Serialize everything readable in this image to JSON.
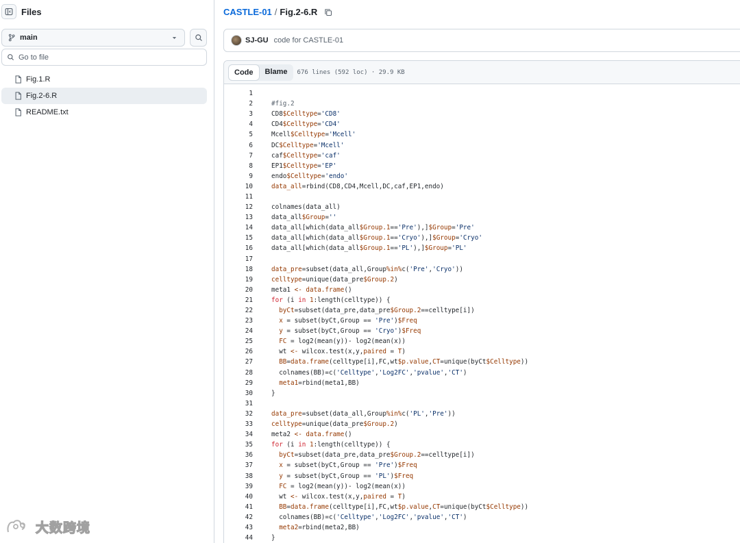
{
  "sidebar": {
    "title": "Files",
    "branch": "main",
    "goto_placeholder": "Go to file",
    "files": [
      {
        "name": "Fig.1.R",
        "active": false
      },
      {
        "name": "Fig.2-6.R",
        "active": true
      },
      {
        "name": "README.txt",
        "active": false
      }
    ]
  },
  "breadcrumb": {
    "repo": "CASTLE-01",
    "separator": "/",
    "file": "Fig.2-6.R"
  },
  "commit": {
    "author": "SJ-GU",
    "message": "code for CASTLE-01"
  },
  "code_toolbar": {
    "code_tab": "Code",
    "blame_tab": "Blame",
    "file_info": "676 lines (592 loc) · 29.9 KB"
  },
  "code": {
    "lines": [
      [],
      [
        [
          "c",
          "#fig.2"
        ]
      ],
      [
        [
          "p",
          "CD8"
        ],
        [
          "v",
          "$Celltype"
        ],
        [
          "p",
          "="
        ],
        [
          "s",
          "'CD8'"
        ]
      ],
      [
        [
          "p",
          "CD4"
        ],
        [
          "v",
          "$Celltype"
        ],
        [
          "p",
          "="
        ],
        [
          "s",
          "'CD4'"
        ]
      ],
      [
        [
          "p",
          "Mcell"
        ],
        [
          "v",
          "$Celltype"
        ],
        [
          "p",
          "="
        ],
        [
          "s",
          "'Mcell'"
        ]
      ],
      [
        [
          "p",
          "DC"
        ],
        [
          "v",
          "$Celltype"
        ],
        [
          "p",
          "="
        ],
        [
          "s",
          "'Mcell'"
        ]
      ],
      [
        [
          "p",
          "caf"
        ],
        [
          "v",
          "$Celltype"
        ],
        [
          "p",
          "="
        ],
        [
          "s",
          "'caf'"
        ]
      ],
      [
        [
          "p",
          "EP1"
        ],
        [
          "v",
          "$Celltype"
        ],
        [
          "p",
          "="
        ],
        [
          "s",
          "'EP'"
        ]
      ],
      [
        [
          "p",
          "endo"
        ],
        [
          "v",
          "$Celltype"
        ],
        [
          "p",
          "="
        ],
        [
          "s",
          "'endo'"
        ]
      ],
      [
        [
          "v",
          "data_all"
        ],
        [
          "p",
          "=rbind(CD8,CD4,Mcell,DC,caf,EP1,endo)"
        ]
      ],
      [],
      [
        [
          "p",
          "colnames(data_all)"
        ]
      ],
      [
        [
          "p",
          "data_all"
        ],
        [
          "v",
          "$Group"
        ],
        [
          "p",
          "="
        ],
        [
          "s",
          "''"
        ]
      ],
      [
        [
          "p",
          "data_all[which(data_all"
        ],
        [
          "v",
          "$Group.1"
        ],
        [
          "p",
          "=="
        ],
        [
          "s",
          "'Pre'"
        ],
        [
          "p",
          "),]"
        ],
        [
          "v",
          "$Group"
        ],
        [
          "p",
          "="
        ],
        [
          "s",
          "'Pre'"
        ]
      ],
      [
        [
          "p",
          "data_all[which(data_all"
        ],
        [
          "v",
          "$Group.1"
        ],
        [
          "p",
          "=="
        ],
        [
          "s",
          "'Cryo'"
        ],
        [
          "p",
          "),]"
        ],
        [
          "v",
          "$Group"
        ],
        [
          "p",
          "="
        ],
        [
          "s",
          "'Cryo'"
        ]
      ],
      [
        [
          "p",
          "data_all[which(data_all"
        ],
        [
          "v",
          "$Group.1"
        ],
        [
          "p",
          "=="
        ],
        [
          "s",
          "'PL'"
        ],
        [
          "p",
          "),]"
        ],
        [
          "v",
          "$Group"
        ],
        [
          "p",
          "="
        ],
        [
          "s",
          "'PL'"
        ]
      ],
      [],
      [
        [
          "v",
          "data_pre"
        ],
        [
          "p",
          "=subset(data_all,Group"
        ],
        [
          "v",
          "%in%"
        ],
        [
          "p",
          "c("
        ],
        [
          "s",
          "'Pre'"
        ],
        [
          "p",
          ","
        ],
        [
          "s",
          "'Cryo'"
        ],
        [
          "p",
          "))"
        ]
      ],
      [
        [
          "v",
          "celltype"
        ],
        [
          "p",
          "=unique(data_pre"
        ],
        [
          "v",
          "$Group.2"
        ],
        [
          "p",
          ")"
        ]
      ],
      [
        [
          "p",
          "meta1 "
        ],
        [
          "v",
          "<-"
        ],
        [
          "p",
          " "
        ],
        [
          "v",
          "data.frame"
        ],
        [
          "p",
          "()"
        ]
      ],
      [
        [
          "k",
          "for"
        ],
        [
          "p",
          " (i "
        ],
        [
          "k",
          "in"
        ],
        [
          "p",
          " "
        ],
        [
          "v",
          "1"
        ],
        [
          "p",
          ":length(celltype)) {"
        ]
      ],
      [
        [
          "p",
          "  "
        ],
        [
          "v",
          "byCt"
        ],
        [
          "p",
          "=subset(data_pre,data_pre"
        ],
        [
          "v",
          "$Group.2"
        ],
        [
          "p",
          "==celltype[i])"
        ]
      ],
      [
        [
          "p",
          "  "
        ],
        [
          "v",
          "x"
        ],
        [
          "p",
          " = subset(byCt,Group == "
        ],
        [
          "s",
          "'Pre'"
        ],
        [
          "p",
          ")"
        ],
        [
          "v",
          "$Freq"
        ]
      ],
      [
        [
          "p",
          "  "
        ],
        [
          "v",
          "y"
        ],
        [
          "p",
          " = subset(byCt,Group == "
        ],
        [
          "s",
          "'Cryo'"
        ],
        [
          "p",
          ")"
        ],
        [
          "v",
          "$Freq"
        ]
      ],
      [
        [
          "p",
          "  "
        ],
        [
          "v",
          "FC"
        ],
        [
          "p",
          " = log2(mean(y))- log2(mean(x))"
        ]
      ],
      [
        [
          "p",
          "  wt "
        ],
        [
          "v",
          "<-"
        ],
        [
          "p",
          " wilcox.test(x,y,"
        ],
        [
          "v",
          "paired"
        ],
        [
          "p",
          " = "
        ],
        [
          "v",
          "T"
        ],
        [
          "p",
          ")"
        ]
      ],
      [
        [
          "p",
          "  "
        ],
        [
          "v",
          "BB"
        ],
        [
          "p",
          "="
        ],
        [
          "v",
          "data.frame"
        ],
        [
          "p",
          "(celltype[i],FC,wt"
        ],
        [
          "v",
          "$p.value"
        ],
        [
          "p",
          ","
        ],
        [
          "v",
          "CT"
        ],
        [
          "p",
          "=unique(byCt"
        ],
        [
          "v",
          "$Celltype"
        ],
        [
          "p",
          "))"
        ]
      ],
      [
        [
          "p",
          "  colnames(BB)=c("
        ],
        [
          "s",
          "'Celltype'"
        ],
        [
          "p",
          ","
        ],
        [
          "s",
          "'Log2FC'"
        ],
        [
          "p",
          ","
        ],
        [
          "s",
          "'pvalue'"
        ],
        [
          "p",
          ","
        ],
        [
          "s",
          "'CT'"
        ],
        [
          "p",
          ")"
        ]
      ],
      [
        [
          "p",
          "  "
        ],
        [
          "v",
          "meta1"
        ],
        [
          "p",
          "=rbind(meta1,BB)"
        ]
      ],
      [
        [
          "p",
          "}"
        ]
      ],
      [],
      [
        [
          "v",
          "data_pre"
        ],
        [
          "p",
          "=subset(data_all,Group"
        ],
        [
          "v",
          "%in%"
        ],
        [
          "p",
          "c("
        ],
        [
          "s",
          "'PL'"
        ],
        [
          "p",
          ","
        ],
        [
          "s",
          "'Pre'"
        ],
        [
          "p",
          "))"
        ]
      ],
      [
        [
          "v",
          "celltype"
        ],
        [
          "p",
          "=unique(data_pre"
        ],
        [
          "v",
          "$Group.2"
        ],
        [
          "p",
          ")"
        ]
      ],
      [
        [
          "p",
          "meta2 "
        ],
        [
          "v",
          "<-"
        ],
        [
          "p",
          " "
        ],
        [
          "v",
          "data.frame"
        ],
        [
          "p",
          "()"
        ]
      ],
      [
        [
          "k",
          "for"
        ],
        [
          "p",
          " (i "
        ],
        [
          "k",
          "in"
        ],
        [
          "p",
          " "
        ],
        [
          "v",
          "1"
        ],
        [
          "p",
          ":length(celltype)) {"
        ]
      ],
      [
        [
          "p",
          "  "
        ],
        [
          "v",
          "byCt"
        ],
        [
          "p",
          "=subset(data_pre,data_pre"
        ],
        [
          "v",
          "$Group.2"
        ],
        [
          "p",
          "==celltype[i])"
        ]
      ],
      [
        [
          "p",
          "  "
        ],
        [
          "v",
          "x"
        ],
        [
          "p",
          " = subset(byCt,Group == "
        ],
        [
          "s",
          "'Pre'"
        ],
        [
          "p",
          ")"
        ],
        [
          "v",
          "$Freq"
        ]
      ],
      [
        [
          "p",
          "  "
        ],
        [
          "v",
          "y"
        ],
        [
          "p",
          " = subset(byCt,Group == "
        ],
        [
          "s",
          "'PL'"
        ],
        [
          "p",
          ")"
        ],
        [
          "v",
          "$Freq"
        ]
      ],
      [
        [
          "p",
          "  "
        ],
        [
          "v",
          "FC"
        ],
        [
          "p",
          " = log2(mean(y))- log2(mean(x))"
        ]
      ],
      [
        [
          "p",
          "  wt "
        ],
        [
          "v",
          "<-"
        ],
        [
          "p",
          " wilcox.test(x,y,"
        ],
        [
          "v",
          "paired"
        ],
        [
          "p",
          " = "
        ],
        [
          "v",
          "T"
        ],
        [
          "p",
          ")"
        ]
      ],
      [
        [
          "p",
          "  "
        ],
        [
          "v",
          "BB"
        ],
        [
          "p",
          "="
        ],
        [
          "v",
          "data.frame"
        ],
        [
          "p",
          "(celltype[i],FC,wt"
        ],
        [
          "v",
          "$p.value"
        ],
        [
          "p",
          ","
        ],
        [
          "v",
          "CT"
        ],
        [
          "p",
          "=unique(byCt"
        ],
        [
          "v",
          "$Celltype"
        ],
        [
          "p",
          "))"
        ]
      ],
      [
        [
          "p",
          "  colnames(BB)=c("
        ],
        [
          "s",
          "'Celltype'"
        ],
        [
          "p",
          ","
        ],
        [
          "s",
          "'Log2FC'"
        ],
        [
          "p",
          ","
        ],
        [
          "s",
          "'pvalue'"
        ],
        [
          "p",
          ","
        ],
        [
          "s",
          "'CT'"
        ],
        [
          "p",
          ")"
        ]
      ],
      [
        [
          "p",
          "  "
        ],
        [
          "v",
          "meta2"
        ],
        [
          "p",
          "=rbind(meta2,BB)"
        ]
      ],
      [
        [
          "p",
          "}"
        ]
      ]
    ]
  },
  "watermark": {
    "text": "大数跨境"
  },
  "colors": {
    "link": "#0969da",
    "keyword": "#cf222e",
    "variable": "#953800",
    "string": "#0a3069",
    "comment": "#59636e",
    "border": "#d0d7de"
  },
  "icons": [
    "sidebar-collapse-icon",
    "git-branch-icon",
    "caret-down-icon",
    "search-icon",
    "file-icon",
    "copy-icon"
  ]
}
